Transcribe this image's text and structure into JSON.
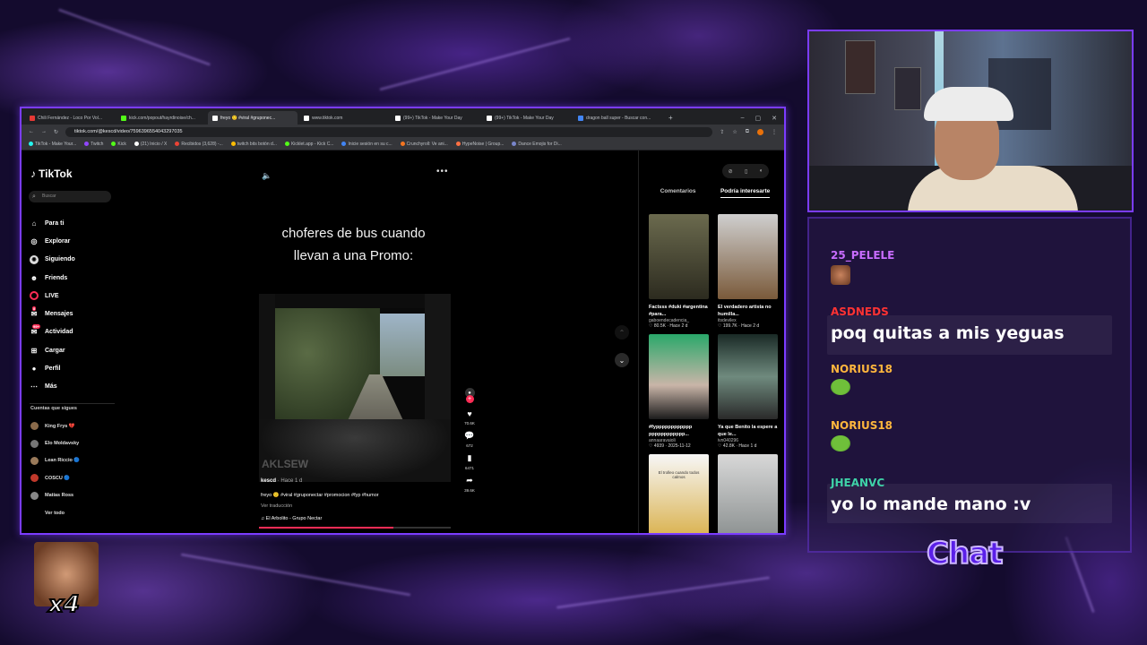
{
  "browser": {
    "tabs": [
      {
        "label": "Chili Fernández - Loco Por Vol...",
        "color": "#e53935"
      },
      {
        "label": "kick.com/popout/hayrdinoise/ch...",
        "color": "#53fc18"
      },
      {
        "label": "freyo 🙂 #viral #gruponec...",
        "color": "#ffffff"
      },
      {
        "label": "www.tiktok.com",
        "color": "#ffffff"
      },
      {
        "label": "(99+) TikTok - Make Your Day",
        "color": "#ffffff"
      },
      {
        "label": "(99+) TikTok - Make Your Day",
        "color": "#ffffff"
      },
      {
        "label": "dragon ball super - Buscar con...",
        "color": "#4285f4"
      }
    ],
    "active_tab_index": 2,
    "url": "tiktok.com/@kescd/video/7596396554043297035",
    "bookmarks": [
      "TikTok - Make Your...",
      "Twitch",
      "Kick",
      "(21) Inicio / X",
      "Recibidos (3,628) -...",
      "twitch bits botón d...",
      "Kicklet.app - Kick C...",
      "Inicie sesión en su c...",
      "Crunchyroll: Ve ani...",
      "HypeNoise | Group...",
      "Dance Emojis for Di..."
    ]
  },
  "tiktok": {
    "logo": "TikTok",
    "search_placeholder": "Buscar",
    "nav": [
      {
        "label": "Para ti",
        "icon": "home-icon",
        "glyph": "⌂"
      },
      {
        "label": "Explorar",
        "icon": "compass-icon",
        "glyph": "◎"
      },
      {
        "label": "Siguiendo",
        "icon": "following-icon",
        "glyph": "◉"
      },
      {
        "label": "Friends",
        "icon": "friends-icon",
        "glyph": "☻"
      },
      {
        "label": "LIVE",
        "icon": "live-icon",
        "glyph": ""
      },
      {
        "label": "Mensajes",
        "icon": "messages-icon",
        "glyph": "✉",
        "badge": "8"
      },
      {
        "label": "Actividad",
        "icon": "activity-icon",
        "glyph": "✉",
        "badge": "99+"
      },
      {
        "label": "Cargar",
        "icon": "upload-icon",
        "glyph": "⊞"
      },
      {
        "label": "Perfil",
        "icon": "profile-icon",
        "glyph": "●"
      },
      {
        "label": "Más",
        "icon": "more-icon",
        "glyph": "⋯"
      }
    ],
    "following_title": "Cuentas que sigues",
    "following": [
      "King Frys 💔",
      "Elo Moldavsky",
      "Lean Riccio 🔵",
      "COSCU 🔵",
      "Matías Ross",
      "Ver todo"
    ],
    "video": {
      "caption_line1": "choferes de bus cuando",
      "caption_line2": "llevan a una Promo:",
      "watermark": "AKLSEW",
      "author": "kescd",
      "time": "· Hace 1 d",
      "description": "freyo 🙂 #viral #gruponectar #promocion #fyp #humor",
      "translate": "Ver traducción",
      "music": "♫  El Arbolito - Grupo Nectar",
      "progress": 0.7,
      "likes": "70.6K",
      "comments": "672",
      "saves": "6471",
      "shares": "39.6K"
    },
    "right_tabs": [
      "Comentarios",
      "Podría interesarte"
    ],
    "cards": [
      {
        "title": "Factsss #duki #argentina #para...",
        "user": "gaboendecadencia_",
        "meta": "♡ 80.5K · Hace 2 d",
        "thumb_text": ""
      },
      {
        "title": "El verdadero artista no humilla...",
        "user": "itsdevilex",
        "meta": "♡ 199.7K · Hace 2 d",
        "thumb_text": ""
      },
      {
        "title": "#fypppppppppppp pppppppppppp...",
        "user": "annaaravaioli",
        "meta": "♡ 4939 · 2025-11-12",
        "thumb_text": ""
      },
      {
        "title": "Ya que Benito la espere a que le...",
        "user": "ivn040296",
        "meta": "♡ 42.8K · Hace 1 d",
        "thumb_text": ""
      },
      {
        "title": "",
        "user": "",
        "meta": "",
        "thumb_text": "El trolleo cuando todos calmos"
      },
      {
        "title": "",
        "user": "",
        "meta": "",
        "thumb_text": ""
      }
    ]
  },
  "chat": {
    "messages": [
      {
        "user": "25_PELELE",
        "color": "#c86cff",
        "text": "",
        "emote": "face"
      },
      {
        "user": "ASDNEDS",
        "color": "#ff3333",
        "text": "poq quitas a mis yeguas",
        "emote": ""
      },
      {
        "user": "NORIUS18",
        "color": "#ffb63d",
        "text": "",
        "emote": "pepe"
      },
      {
        "user": "NORIUS18",
        "color": "#ffb63d",
        "text": "",
        "emote": "pepe"
      },
      {
        "user": "JHEANVC",
        "color": "#3fd3a8",
        "text": "yo lo mande mano :v",
        "emote": ""
      }
    ],
    "label": "Chat"
  },
  "emote_overlay": {
    "multiplier": "x4"
  }
}
